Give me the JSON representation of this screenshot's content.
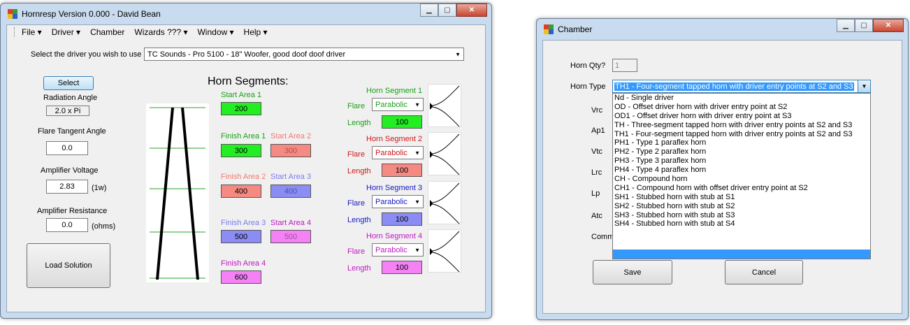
{
  "main_window": {
    "title": "Hornresp Version 0.000 - David Bean",
    "menu": [
      "File ▾",
      "Driver ▾",
      "Chamber",
      "Wizards ??? ▾",
      "Window ▾",
      "Help ▾"
    ],
    "driver_prompt": "Select the driver you wish to use",
    "driver_selected": "TC Sounds - Pro 5100 - 18\" Woofer, good doof doof driver",
    "select_button": "Select",
    "radiation_angle_label": "Radiation Angle",
    "radiation_angle_value": "2.0 x Pi",
    "flare_tangent_label": "Flare Tangent Angle",
    "flare_tangent_value": "0.0",
    "amp_voltage_label": "Amplifier Voltage",
    "amp_voltage_value": "2.83",
    "amp_voltage_unit": "(1w)",
    "amp_resistance_label": "Amplifier Resistance",
    "amp_resistance_value": "0.0",
    "amp_resistance_unit": "(ohms)",
    "load_button": "Load Solution",
    "horn_segments_heading": "Horn Segments:",
    "areas": {
      "start1_label": "Start Area 1",
      "start1_value": "200",
      "finish1_label": "Finish Area 1",
      "finish1_value": "300",
      "start2_label": "Start Area 2",
      "start2_value": "300",
      "finish2_label": "Finish Area 2",
      "finish2_value": "400",
      "start3_label": "Start Area 3",
      "start3_value": "400",
      "finish3_label": "Finish Area 3",
      "finish3_value": "500",
      "start4_label": "Start Area 4",
      "start4_value": "500",
      "finish4_label": "Finish Area 4",
      "finish4_value": "600"
    },
    "segments": [
      {
        "title": "Horn Segment 1",
        "flare_label": "Flare",
        "flare_value": "Parabolic",
        "length_label": "Length",
        "length_value": "100",
        "color": "#1aa01a",
        "fill": "#22ee22"
      },
      {
        "title": "Horn Segment 2",
        "flare_label": "Flare",
        "flare_value": "Parabolic",
        "length_label": "Length",
        "length_value": "100",
        "color": "#d01818",
        "fill": "#f58a82"
      },
      {
        "title": "Horn Segment 3",
        "flare_label": "Flare",
        "flare_value": "Parabolic",
        "length_label": "Length",
        "length_value": "100",
        "color": "#1818c8",
        "fill": "#8c8cf5"
      },
      {
        "title": "Horn Segment 4",
        "flare_label": "Flare",
        "flare_value": "Parabolic",
        "length_label": "Length",
        "length_value": "100",
        "color": "#c018c0",
        "fill": "#f582f5"
      }
    ]
  },
  "chamber_window": {
    "title": "Chamber",
    "horn_qty_label": "Horn Qty?",
    "horn_qty_value": "1",
    "horn_type_label": "Horn Type",
    "horn_type_value": "TH1 - Four-segment tapped horn with driver entry points at S2 and S3",
    "side_labels": [
      "Vrc",
      "Ap1",
      "Vtc",
      "Lrc",
      "Lp",
      "Atc",
      "Comm"
    ],
    "options": [
      "Nd - Single driver",
      "OD - Offset driver horn with driver entry point at S2",
      "OD1 - Offset driver horn with driver entry point at S3",
      "TH - Three-segment tapped horn with driver entry points at S2 and S3",
      "TH1 - Four-segment tapped horn with driver entry points at S2 and S3",
      "PH1 - Type 1 paraflex horn",
      "PH2 - Type 2 paraflex horn",
      "PH3 - Type 3 paraflex horn",
      "PH4 - Type 4 paraflex horn",
      "CH - Compound horn",
      "CH1 - Compound horn with offset driver entry point at S2",
      "SH1 - Stubbed horn with stub at S1",
      "SH2 - Stubbed horn with stub at S2",
      "SH3 - Stubbed horn with stub at S3",
      "SH4 - Stubbed horn with stub at S4"
    ],
    "save_button": "Save",
    "cancel_button": "Cancel"
  }
}
